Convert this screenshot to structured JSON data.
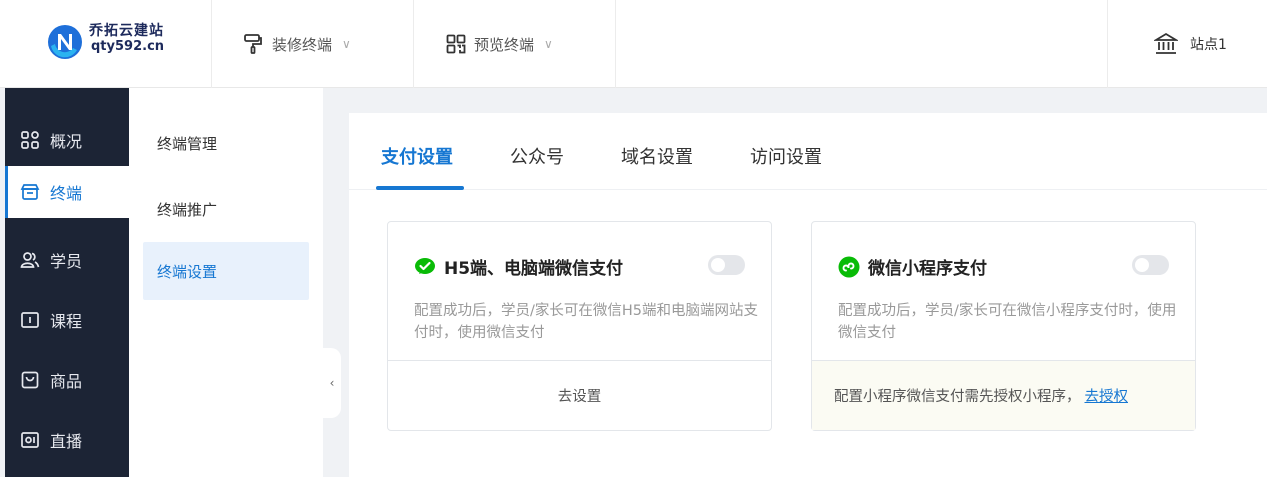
{
  "brand": {
    "name": "乔拓云建站",
    "domain": "qty592.cn"
  },
  "topnav": [
    {
      "label": "装修终端",
      "icon": "paint-roller-icon"
    },
    {
      "label": "预览终端",
      "icon": "qrcode-icon"
    }
  ],
  "site": {
    "label": "站点1",
    "icon": "bank-icon"
  },
  "sidebar": {
    "items": [
      {
        "label": "概况",
        "icon": "grid-icon"
      },
      {
        "label": "终端",
        "icon": "store-icon",
        "active": true
      },
      {
        "label": "学员",
        "icon": "users-icon"
      },
      {
        "label": "课程",
        "icon": "book-icon"
      },
      {
        "label": "商品",
        "icon": "bag-icon"
      },
      {
        "label": "直播",
        "icon": "video-icon"
      }
    ]
  },
  "subnav": {
    "items": [
      {
        "label": "终端管理"
      },
      {
        "label": "终端推广"
      },
      {
        "label": "终端设置",
        "active": true
      }
    ],
    "collapse_glyph": "‹"
  },
  "tabs": [
    {
      "label": "支付设置",
      "active": true
    },
    {
      "label": "公众号"
    },
    {
      "label": "域名设置"
    },
    {
      "label": "访问设置"
    }
  ],
  "cards": {
    "h5": {
      "title": "H5端、电脑端微信支付",
      "desc": "配置成功后，学员/家长可在微信H5端和电脑端网站支付时，使用微信支付",
      "enabled": false,
      "action": "去设置"
    },
    "mini": {
      "title": "微信小程序支付",
      "desc": "配置成功后，学员/家长可在微信小程序支付时，使用微信支付",
      "enabled": false,
      "notice": "配置小程序微信支付需先授权小程序，",
      "link": "去授权"
    }
  },
  "colors": {
    "accent": "#1677d2",
    "sidebar": "#1c2435",
    "wechat_green": "#09bb07"
  }
}
